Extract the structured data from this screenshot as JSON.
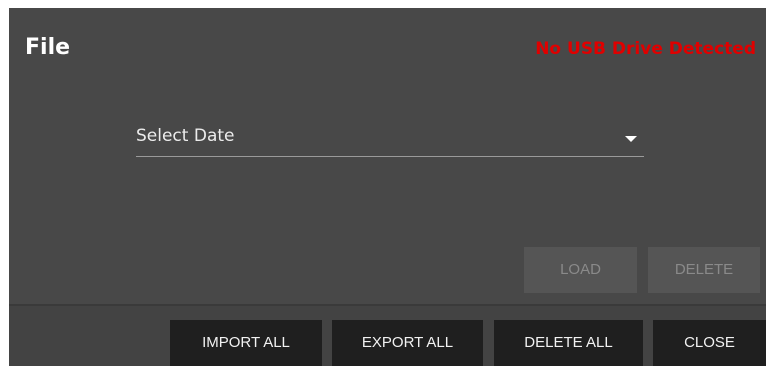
{
  "dialog": {
    "title": "File",
    "usb_status": "No USB Drive Detected"
  },
  "date_select": {
    "label": "Select Date"
  },
  "actions": {
    "load": "LOAD",
    "delete": "DELETE"
  },
  "footer": {
    "import_all": "IMPORT ALL",
    "export_all": "EXPORT ALL",
    "delete_all": "DELETE ALL",
    "close": "CLOSE"
  },
  "colors": {
    "background": "#484848",
    "footer_background": "#434343",
    "warning": "#e00000",
    "button": "#1f1f1f",
    "button_disabled": "#555555"
  }
}
